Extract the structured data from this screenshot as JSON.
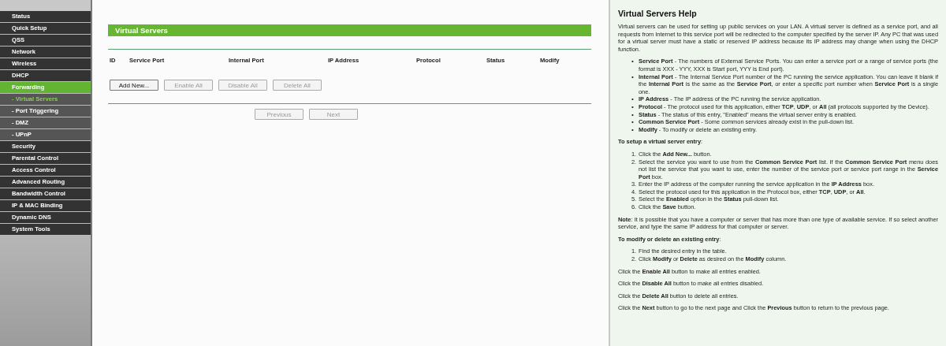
{
  "sidebar": {
    "items": [
      {
        "label": "Status",
        "kind": "main",
        "selected": false
      },
      {
        "label": "Quick Setup",
        "kind": "main",
        "selected": false
      },
      {
        "label": "QSS",
        "kind": "main",
        "selected": false
      },
      {
        "label": "Network",
        "kind": "main",
        "selected": false
      },
      {
        "label": "Wireless",
        "kind": "main",
        "selected": false
      },
      {
        "label": "DHCP",
        "kind": "main",
        "selected": false
      },
      {
        "label": "Forwarding",
        "kind": "main",
        "selected": true
      },
      {
        "label": "- Virtual Servers",
        "kind": "sub",
        "selected": true
      },
      {
        "label": "- Port Triggering",
        "kind": "sub",
        "selected": false
      },
      {
        "label": "- DMZ",
        "kind": "sub",
        "selected": false
      },
      {
        "label": "- UPnP",
        "kind": "sub",
        "selected": false
      },
      {
        "label": "Security",
        "kind": "main",
        "selected": false
      },
      {
        "label": "Parental Control",
        "kind": "main",
        "selected": false
      },
      {
        "label": "Access Control",
        "kind": "main",
        "selected": false
      },
      {
        "label": "Advanced Routing",
        "kind": "main",
        "selected": false
      },
      {
        "label": "Bandwidth Control",
        "kind": "main",
        "selected": false
      },
      {
        "label": "IP & MAC Binding",
        "kind": "main",
        "selected": false
      },
      {
        "label": "Dynamic DNS",
        "kind": "main",
        "selected": false
      },
      {
        "label": "System Tools",
        "kind": "main",
        "selected": false
      }
    ]
  },
  "main": {
    "title": "Virtual Servers",
    "table": {
      "columns": [
        "ID",
        "Service Port",
        "Internal Port",
        "IP Address",
        "Protocol",
        "Status",
        "Modify"
      ]
    },
    "buttons": [
      {
        "label": "Add New...",
        "disabled": false
      },
      {
        "label": "Enable All",
        "disabled": true
      },
      {
        "label": "Disable All",
        "disabled": true
      },
      {
        "label": "Delete All",
        "disabled": true
      }
    ],
    "pager": [
      {
        "label": "Previous",
        "disabled": true
      },
      {
        "label": "Next",
        "disabled": true
      }
    ]
  },
  "help": {
    "title": "Virtual Servers Help",
    "blocks": [
      {
        "kind": "para",
        "text": "Virtual servers can be used for setting up public services on your LAN. A virtual server is defined as a service port, and all requests from Internet to this service port will be redirected to the computer specified by the server IP. Any PC that was used for a virtual server must have a static or reserved IP address because its IP address may change when using the DHCP function."
      },
      {
        "kind": "bullets",
        "items": [
          {
            "marker": "•",
            "text": "**Service Port** - The numbers of External Service Ports. You can enter a service port or a range of service ports (the format is XXX - YYY, XXX is Start port, YYY is End port)."
          },
          {
            "marker": "•",
            "text": "**Internal Port** - The Internal Service Port number of the PC running the service application. You can leave it blank if the **Internal Port** is the same as the **Service Port**, or enter a specific port number when **Service Port** is a single one."
          },
          {
            "marker": "•",
            "text": "**IP Address** - The IP address of the PC running the service application."
          },
          {
            "marker": "•",
            "text": "**Protocol** - The protocol used for this application, either **TCP**, **UDP**, or **All** (all protocols supported by the Device)."
          },
          {
            "marker": "•",
            "text": "**Status** - The status of this entry, \"Enabled\" means the virtual server entry is enabled."
          },
          {
            "marker": "•",
            "text": "**Common Service Port** - Some common services already exist in the pull-down list."
          },
          {
            "marker": "•",
            "text": "**Modify** - To modify or delete an existing entry."
          }
        ]
      },
      {
        "kind": "para",
        "text": "**To setup a virtual server entry**:"
      },
      {
        "kind": "steps",
        "items": [
          {
            "marker": "1.",
            "text": "Click the **Add New...** button."
          },
          {
            "marker": "2.",
            "text": "Select the service you want to use from the **Common Service Port** list. If the **Common Service Port** menu does not list the service that you want to use, enter the number of the service port or service port range in the **Service Port** box."
          },
          {
            "marker": "3.",
            "text": "Enter the IP address of the computer running the service application in the **IP Address** box."
          },
          {
            "marker": "4.",
            "text": "Select the protocol used for this application in the Protocol box, either **TCP**, **UDP**, or **All**."
          },
          {
            "marker": "5.",
            "text": "Select the **Enabled** option in the **Status** pull-down list."
          },
          {
            "marker": "6.",
            "text": "Click the **Save** button."
          }
        ]
      },
      {
        "kind": "para",
        "text": "**Note**: It is possible that you have a computer or server that has more than one type of available service. If so select another service, and type the same IP address for that computer or server."
      },
      {
        "kind": "para",
        "text": "**To modify or delete an existing entry**:"
      },
      {
        "kind": "steps",
        "items": [
          {
            "marker": "1.",
            "text": "Find the desired entry in the table."
          },
          {
            "marker": "2.",
            "text": "Click **Modify** or **Delete** as desired on the **Modify** column."
          }
        ]
      },
      {
        "kind": "para",
        "text": "Click the **Enable All** button to make all entries enabled."
      },
      {
        "kind": "para",
        "text": "Click the **Disable All** button to make all entries disabled."
      },
      {
        "kind": "para",
        "text": "Click the **Delete All** button to delete all entries."
      },
      {
        "kind": "para",
        "text": "Click the **Next** button to go to the next page and Click the **Previous** button to return to the previous page."
      }
    ]
  }
}
